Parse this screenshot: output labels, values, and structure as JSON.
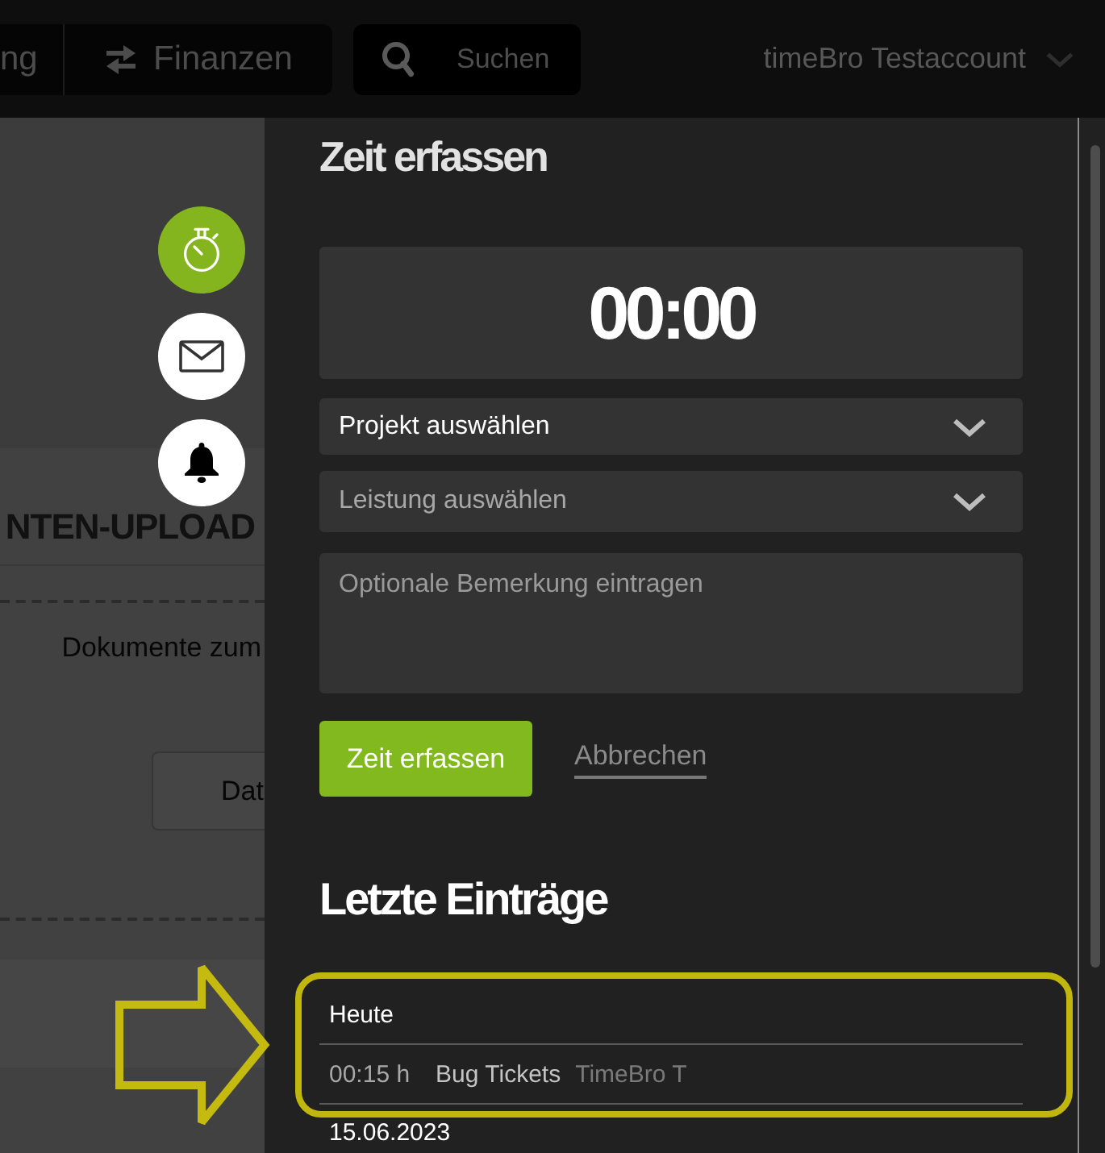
{
  "top_bar": {
    "nav": [
      {
        "label": "ng",
        "icon": false
      },
      {
        "label": "Finanzen",
        "icon": true
      }
    ],
    "search": {
      "placeholder": "Suchen"
    },
    "account": {
      "name": "timeBro Testaccount"
    }
  },
  "page": {
    "heading": "NTEN-UPLOAD",
    "upload_text": "Dokumente zum",
    "upload_button": "Dat"
  },
  "quick_actions": [
    {
      "kind": "timer",
      "selected": true
    },
    {
      "kind": "mail",
      "selected": false
    },
    {
      "kind": "notifications",
      "selected": false
    }
  ],
  "time_panel": {
    "title": "Zeit erfassen",
    "timer": "00:00",
    "selects": [
      {
        "label": "Projekt auswählen",
        "disabled": false
      },
      {
        "label": "Leistung auswählen",
        "disabled": true
      }
    ],
    "remark": {
      "placeholder": "Optionale Bemerkung eintragen"
    },
    "actions": [
      {
        "kind": "primary",
        "label": "Zeit erfassen"
      },
      {
        "kind": "link",
        "label": "Abbrechen"
      }
    ]
  },
  "recent": {
    "title": "Letzte Einträge",
    "groups": [
      {
        "date": "Heute",
        "entries": [
          {
            "duration": "00:15 h",
            "task": "Bug Tickets",
            "project": "TimeBro T"
          }
        ]
      },
      {
        "date": "15.06.2023"
      }
    ]
  }
}
